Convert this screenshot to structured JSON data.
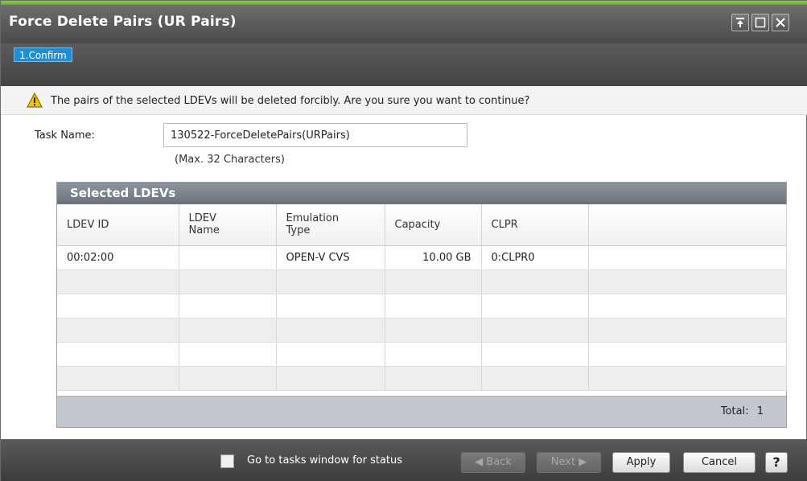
{
  "window": {
    "title": "Force Delete Pairs (UR Pairs)",
    "accent_color": "#6ac12a",
    "controls": [
      "pin-icon",
      "maximize-icon",
      "close-icon"
    ]
  },
  "steps": [
    {
      "label": "1.Confirm",
      "active": true
    }
  ],
  "message": {
    "icon": "warning-icon",
    "text": "The pairs of the selected LDEVs will be deleted forcibly. Are you sure you want to continue?"
  },
  "task": {
    "label": "Task Name:",
    "value": "130522-ForceDeletePairs(URPairs)",
    "hint": "(Max. 32 Characters)"
  },
  "table": {
    "title": "Selected LDEVs",
    "columns": [
      "LDEV ID",
      "LDEV Name",
      "Emulation Type",
      "Capacity",
      "CLPR",
      ""
    ],
    "rows": [
      [
        "00:02:00",
        "",
        "OPEN-V CVS",
        "10.00 GB",
        "0:CLPR0",
        ""
      ]
    ],
    "total_label": "Total:",
    "total_value": "1"
  },
  "footer": {
    "checkbox_label": "Go to tasks window for status",
    "checkbox_checked": false,
    "back_label": "Back",
    "next_label": "Next",
    "apply_label": "Apply",
    "cancel_label": "Cancel",
    "help_label": "?"
  }
}
